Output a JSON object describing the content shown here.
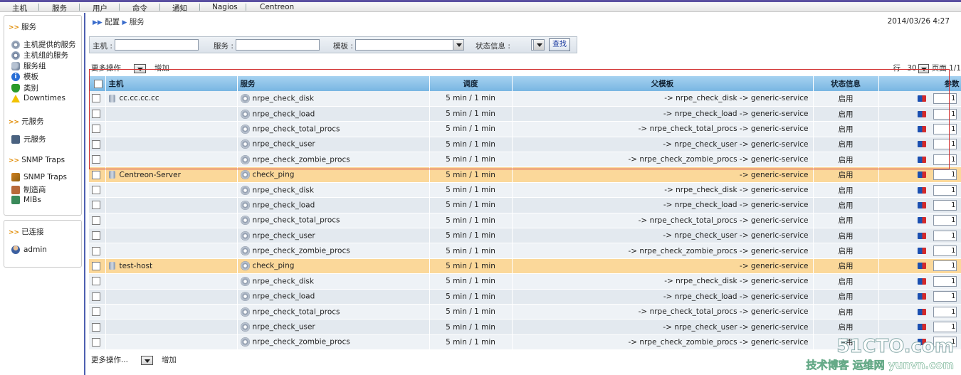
{
  "topnav": {
    "items": [
      "主机",
      "服务",
      "用户",
      "命令",
      "通知",
      "Nagios",
      "Centreon"
    ]
  },
  "sidebar": {
    "services_header": "服务",
    "services_items": [
      "主机提供的服务",
      "主机组的服务",
      "服务组",
      "模板",
      "类别",
      "Downtimes"
    ],
    "meta_header": "元服务",
    "meta_items": [
      "元服务"
    ],
    "snmp_header": "SNMP Traps",
    "snmp_items": [
      "SNMP Traps",
      "制造商",
      "MIBs"
    ],
    "connected_header": "已连接",
    "connected_user": "admin"
  },
  "breadcrumb": {
    "part1": "配置",
    "part2": "服务"
  },
  "datetime": "2014/03/26 4:27",
  "filter": {
    "host_label": "主机 :",
    "service_label": "服务 :",
    "template_label": "模板 :",
    "status_label": "状态信息 :",
    "search_label": "查找"
  },
  "actions": {
    "more": "更多操作",
    "more_bottom": "更多操作...",
    "add": "增加"
  },
  "pager": {
    "rows_label": "行",
    "rows_value": "30",
    "page_label": "页面 1/1"
  },
  "table": {
    "headers": {
      "host": "主机",
      "service": "服务",
      "schedule": "调度",
      "parent": "父模板",
      "status": "状态信息",
      "params": "参数"
    },
    "rows": [
      {
        "host": "cc.cc.cc.cc",
        "service": "nrpe_check_disk",
        "schedule": "5 min / 1 min",
        "parent": "-> nrpe_check_disk -> generic-service",
        "status": "启用",
        "param": "1"
      },
      {
        "host": "",
        "service": "nrpe_check_load",
        "schedule": "5 min / 1 min",
        "parent": "-> nrpe_check_load -> generic-service",
        "status": "启用",
        "param": "1"
      },
      {
        "host": "",
        "service": "nrpe_check_total_procs",
        "schedule": "5 min / 1 min",
        "parent": "-> nrpe_check_total_procs -> generic-service",
        "status": "启用",
        "param": "1"
      },
      {
        "host": "",
        "service": "nrpe_check_user",
        "schedule": "5 min / 1 min",
        "parent": "-> nrpe_check_user -> generic-service",
        "status": "启用",
        "param": "1"
      },
      {
        "host": "",
        "service": "nrpe_check_zombie_procs",
        "schedule": "5 min / 1 min",
        "parent": "-> nrpe_check_zombie_procs -> generic-service",
        "status": "启用",
        "param": "1"
      },
      {
        "host": "Centreon-Server",
        "service": "check_ping",
        "schedule": "5 min / 1 min",
        "parent": "-> generic-service",
        "status": "启用",
        "param": "1",
        "hostrow": true
      },
      {
        "host": "",
        "service": "nrpe_check_disk",
        "schedule": "5 min / 1 min",
        "parent": "-> nrpe_check_disk -> generic-service",
        "status": "启用",
        "param": "1"
      },
      {
        "host": "",
        "service": "nrpe_check_load",
        "schedule": "5 min / 1 min",
        "parent": "-> nrpe_check_load -> generic-service",
        "status": "启用",
        "param": "1"
      },
      {
        "host": "",
        "service": "nrpe_check_total_procs",
        "schedule": "5 min / 1 min",
        "parent": "-> nrpe_check_total_procs -> generic-service",
        "status": "启用",
        "param": "1"
      },
      {
        "host": "",
        "service": "nrpe_check_user",
        "schedule": "5 min / 1 min",
        "parent": "-> nrpe_check_user -> generic-service",
        "status": "启用",
        "param": "1"
      },
      {
        "host": "",
        "service": "nrpe_check_zombie_procs",
        "schedule": "5 min / 1 min",
        "parent": "-> nrpe_check_zombie_procs -> generic-service",
        "status": "启用",
        "param": "1"
      },
      {
        "host": "test-host",
        "service": "check_ping",
        "schedule": "5 min / 1 min",
        "parent": "-> generic-service",
        "status": "启用",
        "param": "1",
        "hostrow": true
      },
      {
        "host": "",
        "service": "nrpe_check_disk",
        "schedule": "5 min / 1 min",
        "parent": "-> nrpe_check_disk -> generic-service",
        "status": "启用",
        "param": "1"
      },
      {
        "host": "",
        "service": "nrpe_check_load",
        "schedule": "5 min / 1 min",
        "parent": "-> nrpe_check_load -> generic-service",
        "status": "启用",
        "param": "1"
      },
      {
        "host": "",
        "service": "nrpe_check_total_procs",
        "schedule": "5 min / 1 min",
        "parent": "-> nrpe_check_total_procs -> generic-service",
        "status": "启用",
        "param": "1"
      },
      {
        "host": "",
        "service": "nrpe_check_user",
        "schedule": "5 min / 1 min",
        "parent": "-> nrpe_check_user -> generic-service",
        "status": "启用",
        "param": "1"
      },
      {
        "host": "",
        "service": "nrpe_check_zombie_procs",
        "schedule": "5 min / 1 min",
        "parent": "-> nrpe_check_zombie_procs -> generic-service",
        "status": "启用",
        "param": "1"
      }
    ]
  },
  "watermark": {
    "line1": "51CTO.com",
    "line2": "技术博客 运维网 yunvn.com"
  }
}
